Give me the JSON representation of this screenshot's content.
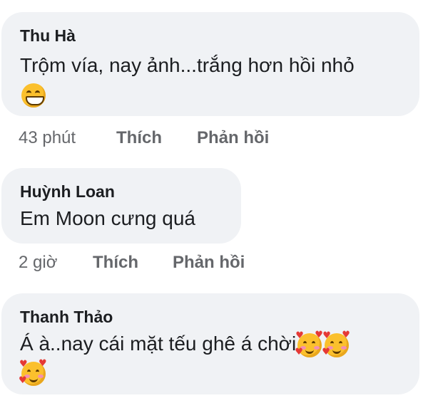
{
  "comments": [
    {
      "author": "Thu Hà",
      "text": "Trộm vía, nay ảnh...trắng hơn hồi nhỏ",
      "emoji": "grinning-face-icon",
      "time": "43 phút",
      "like": "Thích",
      "reply": "Phản hồi"
    },
    {
      "author": "Huỳnh Loan",
      "text": "Em Moon cưng quá",
      "time": "2 giờ",
      "like": "Thích",
      "reply": "Phản hồi"
    },
    {
      "author": "Thanh Thảo",
      "text": "Á à..nay cái mặt tếu ghê á chời",
      "emoji": "smiling-face-with-hearts-icon",
      "emoji_count": 3
    }
  ],
  "colors": {
    "bubble": "#f0f2f5",
    "text": "#1c1e21",
    "meta": "#65676b",
    "emoji_face": "#fbc02d",
    "emoji_heart": "#e53935"
  }
}
